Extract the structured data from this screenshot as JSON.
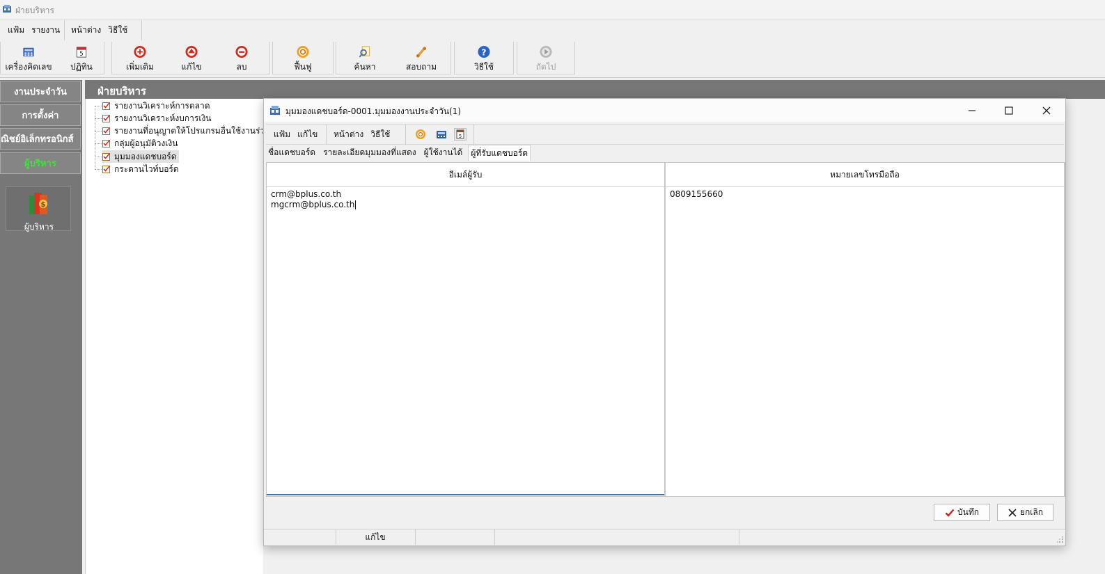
{
  "app": {
    "title": "ฝ่ายบริหาร"
  },
  "menubar": {
    "items": [
      "แฟ้ม",
      "รายงาน",
      "หน้าต่าง",
      "วิธีใช้"
    ]
  },
  "toolbar": {
    "calculator": "เครื่องคิดเลข",
    "calendar": "ปฏิทิน",
    "add": "เพิ่มเติม",
    "edit": "แก้ไข",
    "delete": "ลบ",
    "restore": "ฟื้นฟู",
    "search": "ค้นหา",
    "inquire": "สอบถาม",
    "help": "วิธีใช้",
    "next": "ถัดไป",
    "calendar_day": "5"
  },
  "sidebar": {
    "items": [
      "งานประจำวัน",
      "การตั้งค่า",
      "พาณิชย์อิเล็กทรอนิกส์",
      "ผู้บริหาร"
    ],
    "module_label": "ผู้บริหาร"
  },
  "content": {
    "header": "ฝ่ายบริหาร",
    "tree": [
      "รายงานวิเคราะห์การตลาด",
      "รายงานวิเคราะห์งบการเงิน",
      "รายงานที่อนุญาตให้โปรแกรมอื่นใช้งานร่วม",
      "กลุ่มผู้อนุมัติวงเงิน",
      "มุมมองแดชบอร์ด",
      "กระดานไวท์บอร์ด"
    ]
  },
  "dialog": {
    "title": "มุมมองแดชบอร์ด-0001.มุมมองงานประจำวัน(1)",
    "menu": [
      "แฟ้ม",
      "แก้ไข",
      "หน้าต่าง",
      "วิธีใช้"
    ],
    "tabs": [
      "ชื่อแดชบอร์ด",
      "รายละเอียดมุมมองที่แสดง",
      "ผู้ใช้งานได้",
      "ผู้ที่รับแดชบอร์ด"
    ],
    "columns": {
      "email_header": "อีเมล์ผู้รับ",
      "phone_header": "หมายเลขโทรมือถือ"
    },
    "emails": [
      "crm@bplus.co.th",
      "mgcrm@bplus.co.th"
    ],
    "phones": [
      "0809155660"
    ],
    "save_label": "บันทึก",
    "cancel_label": "ยกเลิก",
    "status_mode": "แก้ไข"
  },
  "colors": {
    "sidebar_bg": "#777777",
    "sidebar_active_text": "#3fe03f",
    "focus_line": "#3c73b5",
    "save_check": "#d0201c"
  }
}
